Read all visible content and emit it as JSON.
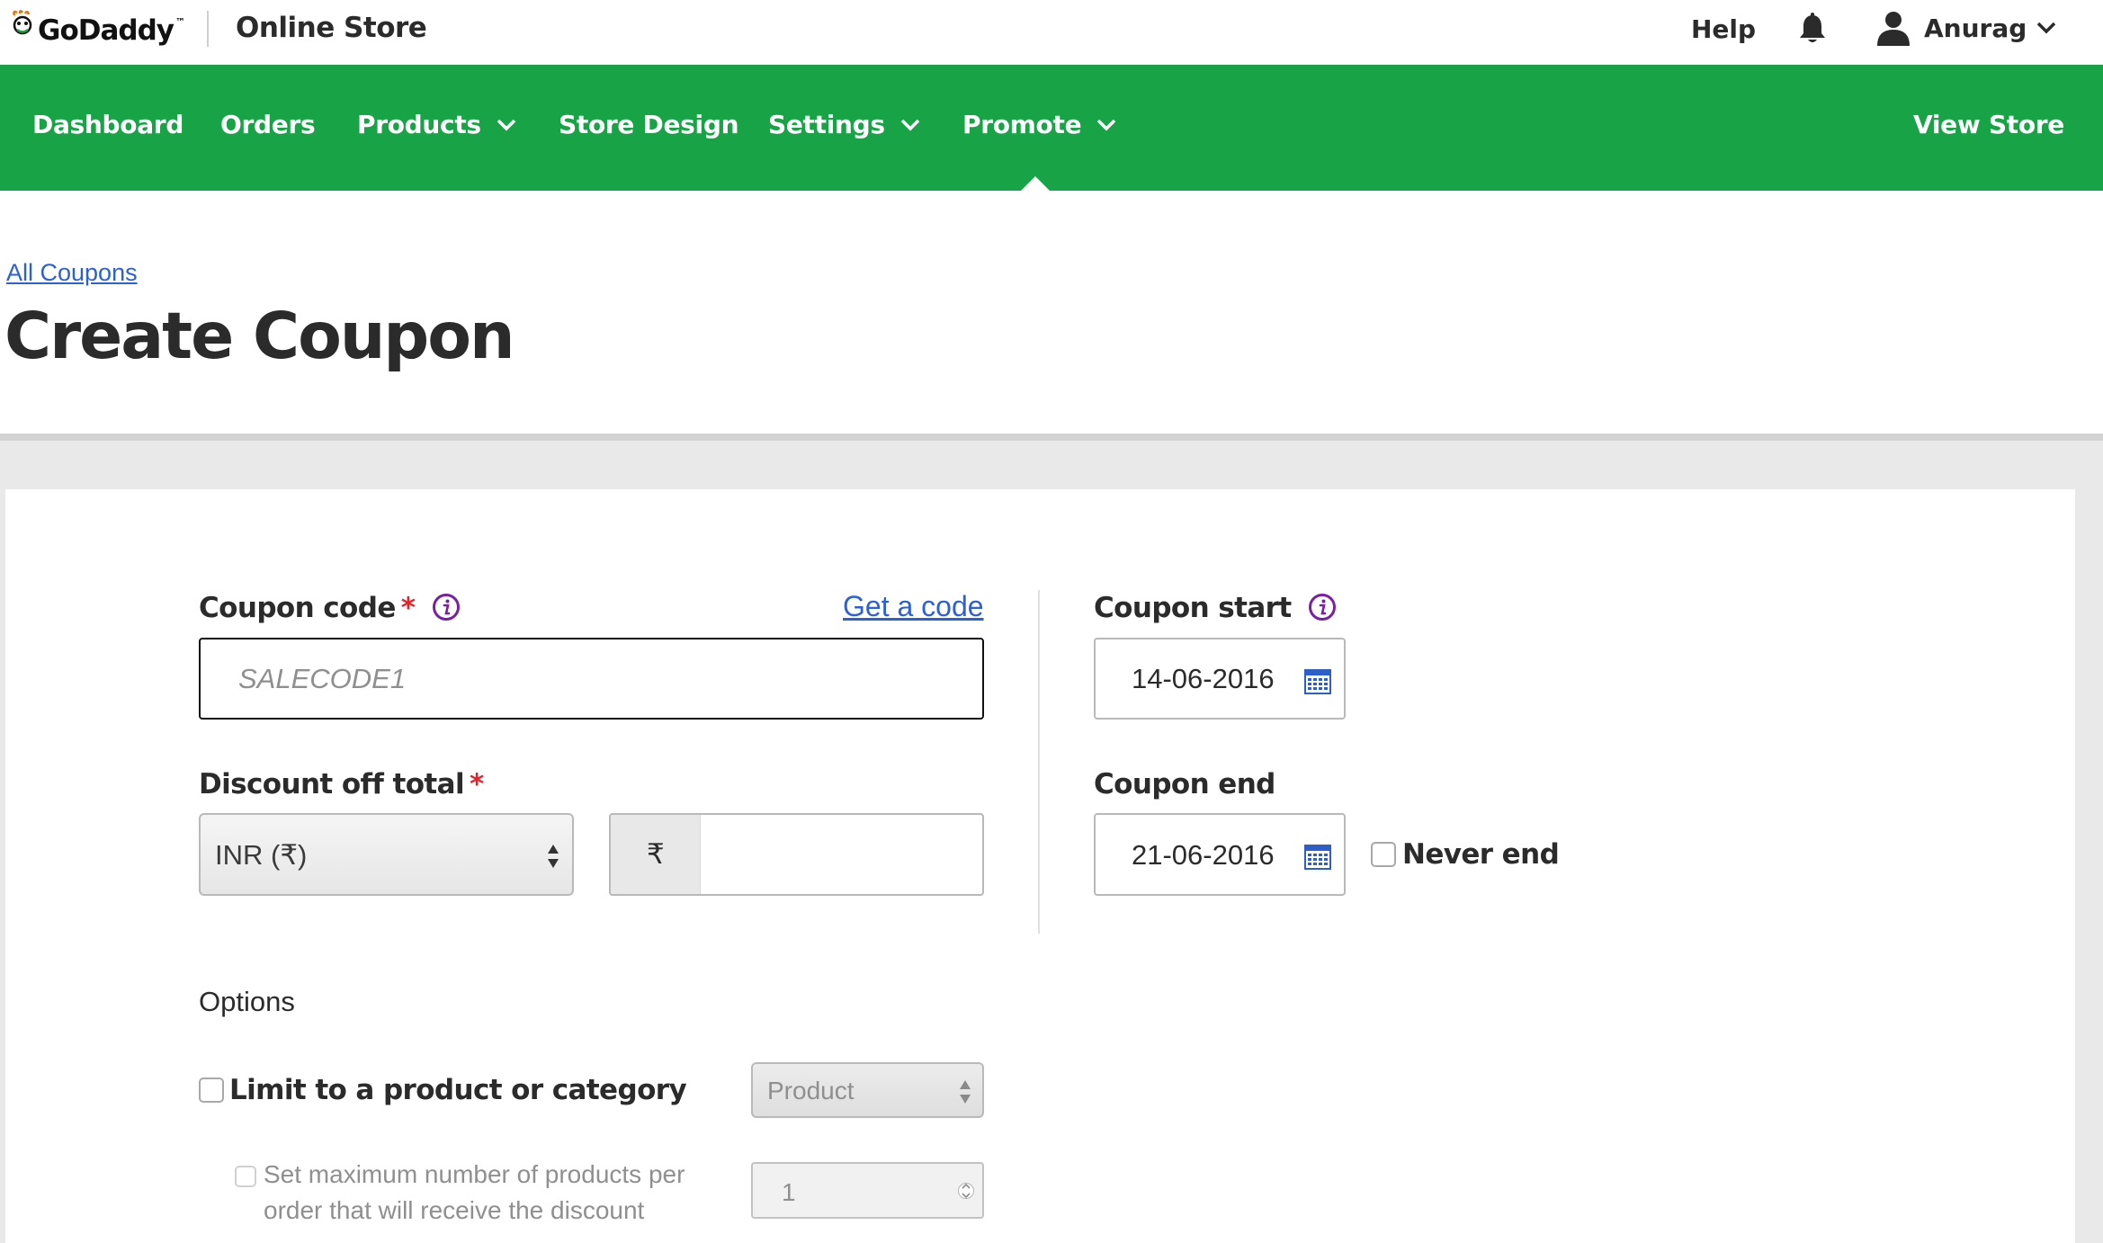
{
  "header": {
    "logo_text": "GoDaddy",
    "logo_tm": "™",
    "product_name": "Online Store",
    "help_label": "Help",
    "user_name": "Anurag"
  },
  "nav": {
    "items": [
      {
        "label": "Dashboard"
      },
      {
        "label": "Orders"
      },
      {
        "label": "Products"
      },
      {
        "label": "Store Design"
      },
      {
        "label": "Settings"
      },
      {
        "label": "Promote"
      },
      {
        "label": "View Store"
      }
    ],
    "active": "Promote"
  },
  "page": {
    "breadcrumb": "All Coupons",
    "title": "Create Coupon"
  },
  "form": {
    "coupon_code": {
      "label": "Coupon code",
      "required_mark": "*",
      "get_code_link": "Get a code",
      "placeholder": "SALECODE1",
      "value": ""
    },
    "discount": {
      "label": "Discount off total",
      "required_mark": "*",
      "currency_selected": "INR (₹)",
      "currency_symbol": "₹",
      "amount_value": ""
    },
    "coupon_start": {
      "label": "Coupon start",
      "value": "14-06-2016"
    },
    "coupon_end": {
      "label": "Coupon end",
      "value": "21-06-2016",
      "never_end_label": "Never end",
      "never_end_checked": false
    },
    "options": {
      "heading": "Options",
      "limit_label": "Limit to a product or category",
      "limit_checked": false,
      "limit_select_value": "Product",
      "max_products_line1": "Set maximum number of products per",
      "max_products_line2": "order that will receive the discount",
      "max_products_checked": false,
      "max_products_value": "1"
    }
  },
  "colors": {
    "nav_green": "#18a347",
    "link_blue": "#2c60d6",
    "required_red": "#e0252b",
    "info_purple": "#7b1fa2",
    "calendar_blue": "#2d5fc9"
  }
}
